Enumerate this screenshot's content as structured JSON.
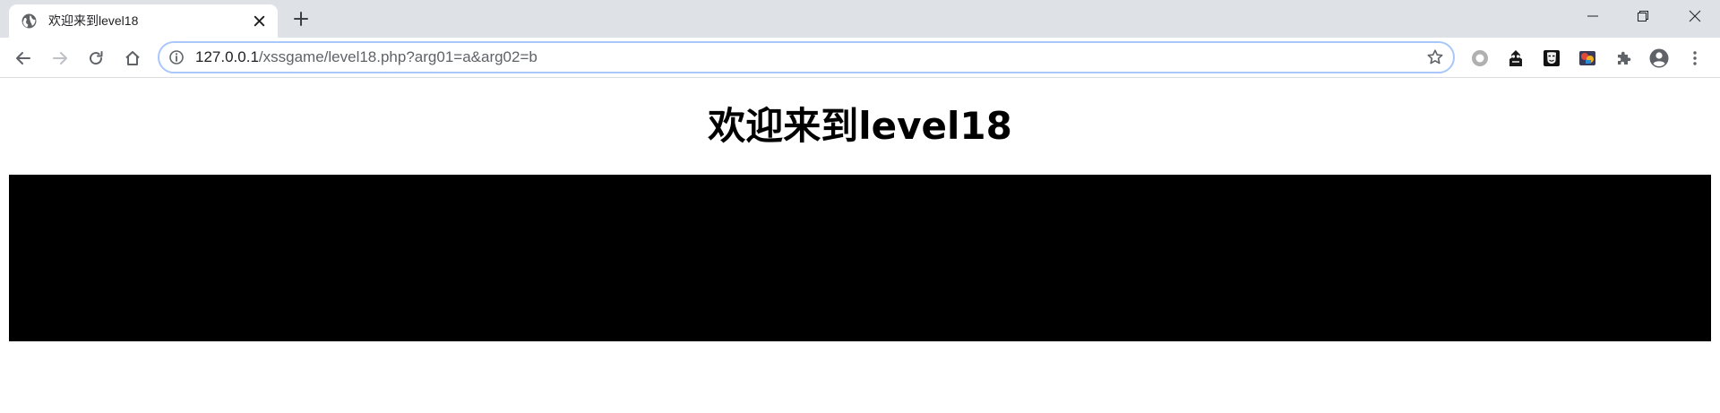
{
  "browser": {
    "tab": {
      "title": "欢迎来到level18",
      "favicon_icon": "globe-icon",
      "close_icon": "close-icon"
    },
    "new_tab_icon": "plus-icon",
    "window_controls": [
      "minimize-icon",
      "restore-icon",
      "close-icon"
    ],
    "nav_icons": [
      "back-arrow-icon",
      "forward-arrow-icon",
      "reload-icon",
      "home-icon"
    ],
    "address_bar": {
      "url_host": "127.0.0.1",
      "url_path": "/xssgame/level18.php?arg01=a&arg02=b",
      "info_icon": "info-icon",
      "star_icon": "bookmark-star-icon"
    },
    "extension_icons": [
      "circle-extension-icon",
      "spy-extension-icon",
      "mask-extension-icon",
      "colorful-extension-icon",
      "puzzle-icon",
      "profile-icon",
      "menu-dots-icon"
    ]
  },
  "page": {
    "heading": "欢迎来到level18",
    "embed": {
      "background": "#000000"
    }
  },
  "colors": {
    "tabstrip_bg": "#dee1e6",
    "omnibox_focus_border": "#a8c7fa",
    "url_host": "#202124",
    "url_path": "#5f6368"
  }
}
